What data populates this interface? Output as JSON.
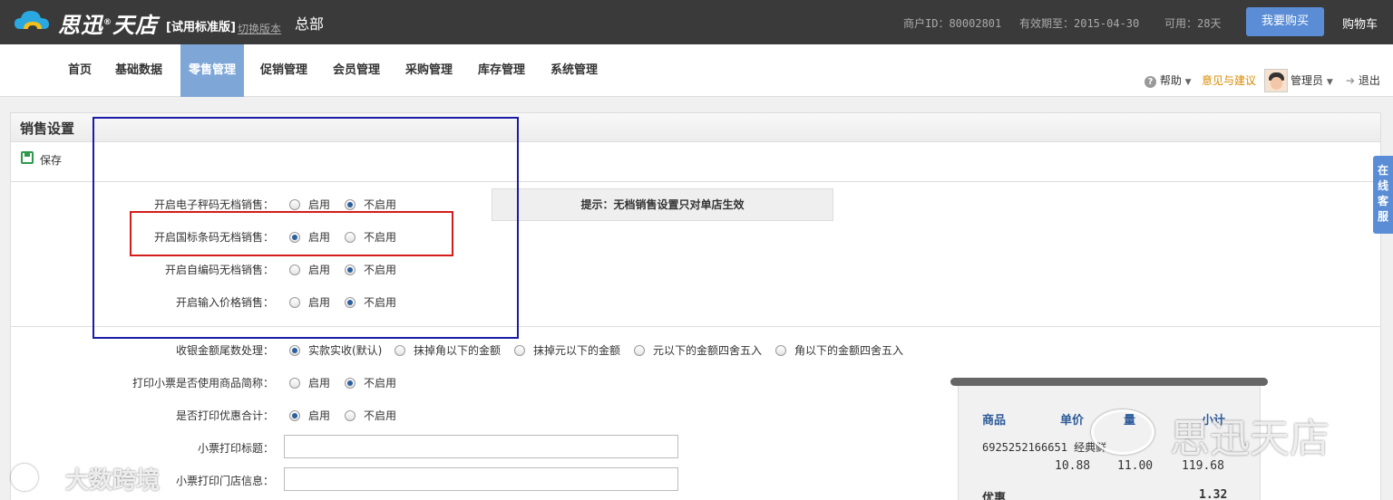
{
  "header": {
    "brand": "思迅",
    "brand_tm": "®",
    "brand_suffix": "天店",
    "edition": "[试用标准版]",
    "switch_link": "切换版本",
    "store": "总部",
    "merchant_id": "商户ID：80002801",
    "valid_until": "有效期至：2015-04-30",
    "days_left": "可用：28天",
    "buy_label": "我要购买",
    "cart_label": "购物车"
  },
  "nav": {
    "items": [
      {
        "label": "首页"
      },
      {
        "label": "基础数据"
      },
      {
        "label": "零售管理",
        "active": true
      },
      {
        "label": "促销管理"
      },
      {
        "label": "会员管理"
      },
      {
        "label": "采购管理"
      },
      {
        "label": "库存管理"
      },
      {
        "label": "系统管理"
      }
    ],
    "help": "帮助",
    "feedback": "意见与建议",
    "user": "管理员",
    "logout": "退出",
    "feedback_color": "#d98a00"
  },
  "panel": {
    "title": "销售设置",
    "save_label": "保存",
    "tip": "提示：无档销售设置只对单店生效",
    "rows": [
      {
        "label": "开启电子秤码无档销售：",
        "options": [
          "启用",
          "不启用"
        ],
        "selected": 1
      },
      {
        "label": "开启国标条码无档销售：",
        "options": [
          "启用",
          "不启用"
        ],
        "selected": 0
      },
      {
        "label": "开启自编码无档销售：",
        "options": [
          "启用",
          "不启用"
        ],
        "selected": 1
      },
      {
        "label": "开启输入价格销售：",
        "options": [
          "启用",
          "不启用"
        ],
        "selected": 1
      },
      {
        "label": "收银金额尾数处理：",
        "options": [
          "实款实收(默认)",
          "抹掉角以下的金额",
          "抹掉元以下的金额",
          "元以下的金额四舍五入",
          "角以下的金额四舍五入"
        ],
        "selected": 0
      },
      {
        "label": "打印小票是否使用商品简称：",
        "options": [
          "启用",
          "不启用"
        ],
        "selected": 1
      },
      {
        "label": "是否打印优惠合计：",
        "options": [
          "启用",
          "不启用"
        ],
        "selected": 0
      }
    ],
    "receipt_title_label": "小票打印标题：",
    "receipt_title_value": "",
    "receipt_store_label": "小票打印门店信息：",
    "receipt_store_value": ""
  },
  "receipt_preview": {
    "col_item": "商品",
    "col_price": "单价",
    "col_qty": "量",
    "col_subtotal": "小计",
    "item_code": "6925252166651 经典鲜",
    "price": "10.88",
    "qty": "11.00",
    "subtotal": "119.68",
    "discount_label": "优惠",
    "discount_value": "1.32"
  },
  "side_service": "在线客服",
  "watermarks": {
    "left": "大数跨境",
    "right": "思迅天店"
  },
  "colors": {
    "topbar": "#3a3a3a",
    "nav_active": "#7ea7d8",
    "buy_button": "#5a8dd6",
    "highlight_blue": "#1b1ba8",
    "highlight_red": "#d41c1c"
  }
}
